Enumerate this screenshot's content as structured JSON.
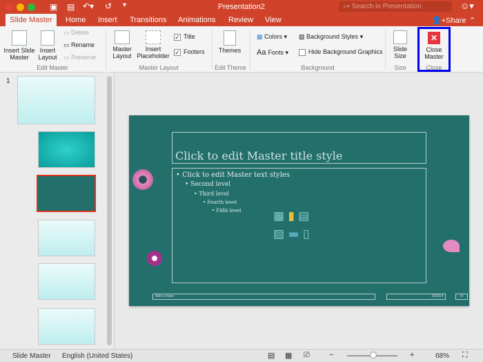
{
  "window": {
    "title": "Presentation2",
    "search_placeholder": "Search in Presentation"
  },
  "tabs": [
    {
      "label": "Slide Master",
      "active": true
    },
    {
      "label": "Home"
    },
    {
      "label": "Insert"
    },
    {
      "label": "Transitions"
    },
    {
      "label": "Animations"
    },
    {
      "label": "Review"
    },
    {
      "label": "View"
    }
  ],
  "share_label": "Share",
  "ribbon": {
    "edit_master": {
      "label": "Edit Master",
      "insert_slide_master": "Insert Slide Master",
      "insert_layout": "Insert Layout",
      "delete": "Delete",
      "rename": "Rename",
      "preserve": "Preserve"
    },
    "master_layout": {
      "label": "Master Layout",
      "master_layout": "Master Layout",
      "insert_placeholder": "Insert Placeholder",
      "title": "Title",
      "title_checked": true,
      "footers": "Footers",
      "footers_checked": true
    },
    "edit_theme": {
      "label": "Edit Theme",
      "themes": "Themes"
    },
    "background": {
      "label": "Background",
      "colors": "Colors",
      "fonts": "Fonts",
      "background_styles": "Background Styles",
      "hide_background_graphics": "Hide Background Graphics",
      "hide_checked": false
    },
    "size": {
      "label": "Size",
      "slide_size": "Slide Size"
    },
    "close": {
      "label": "Close",
      "close_master": "Close Master"
    }
  },
  "thumbnails": {
    "number": "1",
    "selected": 3
  },
  "slide": {
    "title": "Click to edit Master title style",
    "levels": [
      "Click to edit Master text styles",
      "Second level",
      "Third level",
      "Fourth level",
      "Fifth level"
    ],
    "footer": "Add a footer",
    "date": "2/20/14",
    "page": "‹#›"
  },
  "status": {
    "view": "Slide Master",
    "language": "English (United States)",
    "zoom_percent": 68,
    "zoom_label": "68%"
  },
  "colors": {
    "accent": "#d0432a",
    "slide_bg": "#236f6c",
    "highlight": "#0000ee"
  }
}
